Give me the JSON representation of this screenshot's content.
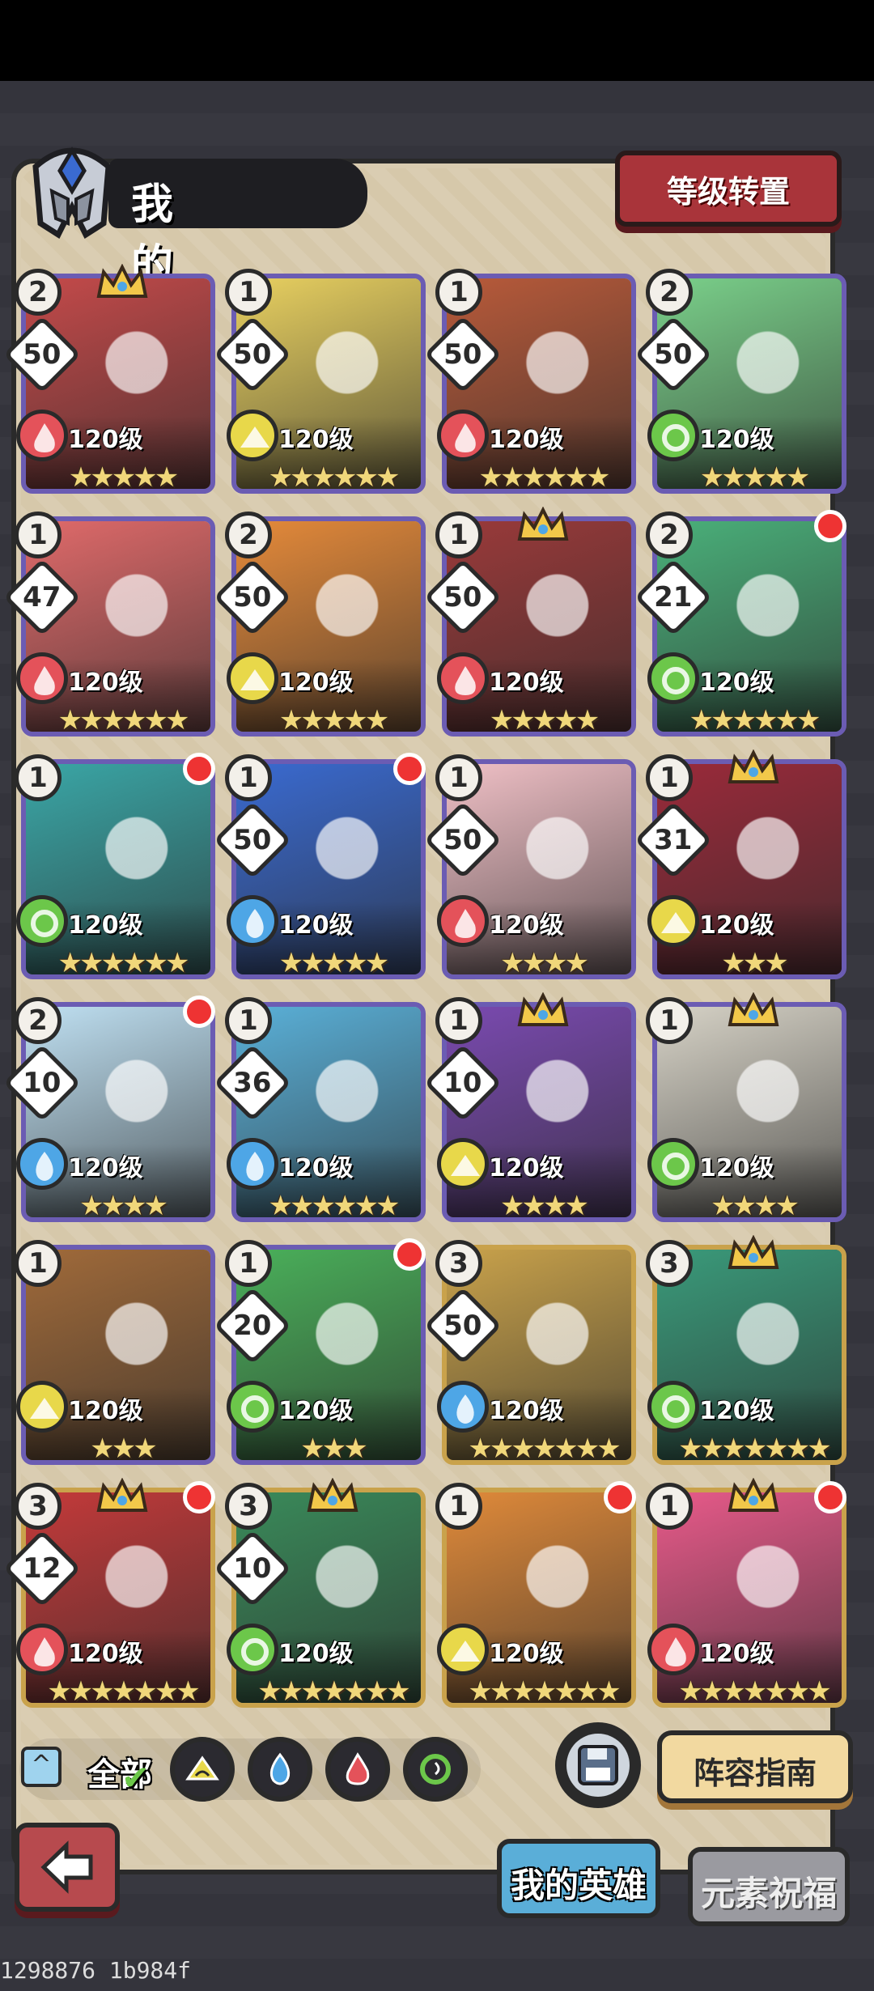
{
  "header": {
    "title": "我的英雄",
    "reset_button": "等级转置"
  },
  "colors": {
    "fire": "#e4525a",
    "earth": "#e8d84a",
    "water": "#4ea6e6",
    "wind": "#6cc74a",
    "accent_red": "#a9343a"
  },
  "heroes": [
    {
      "rank": "2",
      "count": "50",
      "element": "fire",
      "level": "120级",
      "stars": 5,
      "crown": true,
      "red_dot": false,
      "bg": "#c44a4a",
      "frame": "purple"
    },
    {
      "rank": "1",
      "count": "50",
      "element": "earth",
      "level": "120级",
      "stars": 6,
      "crown": false,
      "red_dot": false,
      "bg": "#e8d060",
      "frame": "purple"
    },
    {
      "rank": "1",
      "count": "50",
      "element": "fire",
      "level": "120级",
      "stars": 6,
      "crown": false,
      "red_dot": false,
      "bg": "#b85a3a",
      "frame": "purple"
    },
    {
      "rank": "2",
      "count": "50",
      "element": "wind",
      "level": "120级",
      "stars": 5,
      "crown": false,
      "red_dot": false,
      "bg": "#7ad08a",
      "frame": "purple"
    },
    {
      "rank": "1",
      "count": "47",
      "element": "fire",
      "level": "120级",
      "stars": 6,
      "crown": false,
      "red_dot": false,
      "bg": "#e06a6a",
      "frame": "purple"
    },
    {
      "rank": "2",
      "count": "50",
      "element": "earth",
      "level": "120级",
      "stars": 5,
      "crown": false,
      "red_dot": false,
      "bg": "#e58a3a",
      "frame": "purple"
    },
    {
      "rank": "1",
      "count": "50",
      "element": "fire",
      "level": "120级",
      "stars": 5,
      "crown": true,
      "red_dot": false,
      "bg": "#9a3a3a",
      "frame": "purple"
    },
    {
      "rank": "2",
      "count": "21",
      "element": "wind",
      "level": "120级",
      "stars": 6,
      "crown": false,
      "red_dot": true,
      "bg": "#4ab07a",
      "frame": "purple"
    },
    {
      "rank": "1",
      "count": "",
      "element": "wind",
      "level": "120级",
      "stars": 6,
      "crown": false,
      "red_dot": true,
      "bg": "#3aa6a6",
      "frame": "purple"
    },
    {
      "rank": "1",
      "count": "50",
      "element": "water",
      "level": "120级",
      "stars": 5,
      "crown": false,
      "red_dot": true,
      "bg": "#3a6ad0",
      "frame": "purple"
    },
    {
      "rank": "1",
      "count": "50",
      "element": "fire",
      "level": "120级",
      "stars": 4,
      "crown": false,
      "red_dot": false,
      "bg": "#f0c0c6",
      "frame": "purple"
    },
    {
      "rank": "1",
      "count": "31",
      "element": "earth",
      "level": "120级",
      "stars": 3,
      "crown": true,
      "red_dot": false,
      "bg": "#9a2a3a",
      "frame": "purple"
    },
    {
      "rank": "2",
      "count": "10",
      "element": "water",
      "level": "120级",
      "stars": 4,
      "crown": false,
      "red_dot": true,
      "bg": "#bfe0f2",
      "frame": "purple"
    },
    {
      "rank": "1",
      "count": "36",
      "element": "water",
      "level": "120级",
      "stars": 6,
      "crown": false,
      "red_dot": false,
      "bg": "#5ab0d8",
      "frame": "purple"
    },
    {
      "rank": "1",
      "count": "10",
      "element": "earth",
      "level": "120级",
      "stars": 4,
      "crown": true,
      "red_dot": false,
      "bg": "#7a4ab0",
      "frame": "purple"
    },
    {
      "rank": "1",
      "count": "",
      "element": "wind",
      "level": "120级",
      "stars": 4,
      "crown": true,
      "red_dot": false,
      "bg": "#d6d2c6",
      "frame": "purple"
    },
    {
      "rank": "1",
      "count": "",
      "element": "earth",
      "level": "120级",
      "stars": 3,
      "crown": false,
      "red_dot": false,
      "bg": "#a06a3a",
      "frame": "purple"
    },
    {
      "rank": "1",
      "count": "20",
      "element": "wind",
      "level": "120级",
      "stars": 3,
      "crown": false,
      "red_dot": true,
      "bg": "#4ab05a",
      "frame": "purple"
    },
    {
      "rank": "3",
      "count": "50",
      "element": "water",
      "level": "120级",
      "stars": 7,
      "crown": false,
      "red_dot": false,
      "bg": "#c9a24b",
      "frame": "gold"
    },
    {
      "rank": "3",
      "count": "",
      "element": "wind",
      "level": "120级",
      "stars": 7,
      "crown": true,
      "red_dot": false,
      "bg": "#3a9a7a",
      "frame": "gold"
    },
    {
      "rank": "3",
      "count": "12",
      "element": "fire",
      "level": "120级",
      "stars": 7,
      "crown": true,
      "red_dot": true,
      "bg": "#c43a3a",
      "frame": "gold"
    },
    {
      "rank": "3",
      "count": "10",
      "element": "wind",
      "level": "120级",
      "stars": 7,
      "crown": true,
      "red_dot": false,
      "bg": "#3a8a5a",
      "frame": "gold"
    },
    {
      "rank": "1",
      "count": "",
      "element": "earth",
      "level": "120级",
      "stars": 7,
      "crown": false,
      "red_dot": true,
      "bg": "#e08a3a",
      "frame": "gold"
    },
    {
      "rank": "1",
      "count": "",
      "element": "fire",
      "level": "120级",
      "stars": 7,
      "crown": true,
      "red_dot": true,
      "bg": "#e85a8a",
      "frame": "gold"
    }
  ],
  "filters": {
    "all_label": "全部",
    "selected": "all",
    "elements": [
      "earth",
      "water",
      "fire",
      "wind"
    ]
  },
  "buttons": {
    "guide": "阵容指南"
  },
  "tabs": {
    "my_heroes": "我的英雄",
    "element_blessing": "元素祝福"
  },
  "debug_text": "1298876 1b984f"
}
